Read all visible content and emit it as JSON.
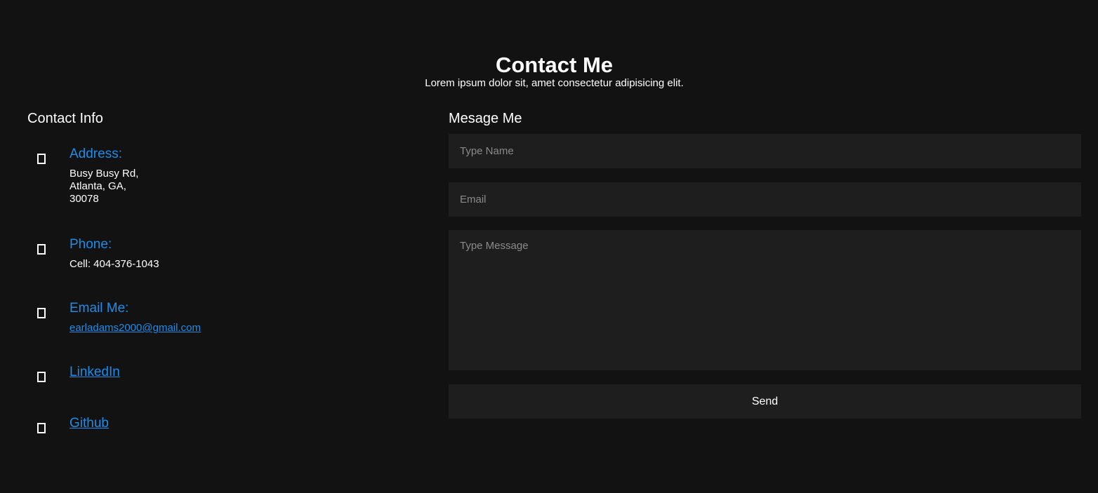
{
  "header": {
    "title": "Contact Me",
    "subtitle": "Lorem ipsum dolor sit, amet consectetur adipisicing elit."
  },
  "contact_info": {
    "title": "Contact Info",
    "address": {
      "label": "Address:",
      "lines": [
        "Busy Busy Rd,",
        "Atlanta, GA,",
        "30078"
      ],
      "icon": "map-marker-icon"
    },
    "phone": {
      "label": "Phone:",
      "value": "Cell: 404-376-1043",
      "icon": "phone-icon"
    },
    "email": {
      "label": "Email Me:",
      "value": "earladams2000@gmail.com",
      "icon": "envelope-icon"
    },
    "linkedin": {
      "label": "LinkedIn",
      "icon": "linkedin-icon"
    },
    "github": {
      "label": "Github",
      "icon": "github-icon"
    }
  },
  "message_form": {
    "title": "Mesage Me",
    "name_placeholder": "Type Name",
    "email_placeholder": "Email",
    "message_placeholder": "Type Message",
    "send_label": "Send"
  },
  "colors": {
    "background": "#121212",
    "accent": "#1e8ce8",
    "field_background": "#1e1e1e"
  }
}
